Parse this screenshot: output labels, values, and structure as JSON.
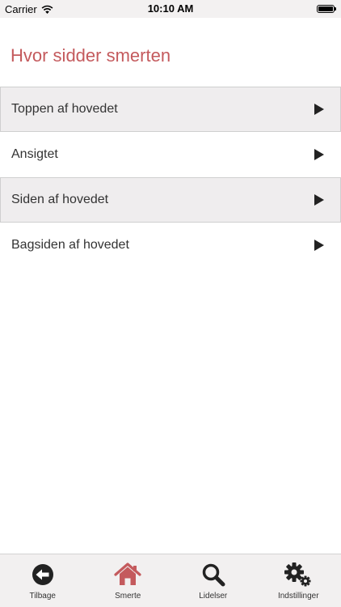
{
  "status_bar": {
    "carrier": "Carrier",
    "time": "10:10 AM",
    "battery_level": 1.0
  },
  "page": {
    "title": "Hvor sidder smerten",
    "title_color": "#c45a5d"
  },
  "list": {
    "items": [
      {
        "label": "Toppen af hovedet"
      },
      {
        "label": "Ansigtet"
      },
      {
        "label": "Siden af hovedet"
      },
      {
        "label": "Bagsiden af hovedet"
      }
    ]
  },
  "tabbar": {
    "active_color": "#c45a5d",
    "items": [
      {
        "label": "Tilbage",
        "icon": "back-arrow-circle-icon"
      },
      {
        "label": "Smerte",
        "icon": "home-icon",
        "active": true
      },
      {
        "label": "Lidelser",
        "icon": "search-icon"
      },
      {
        "label": "Indstillinger",
        "icon": "gears-icon"
      }
    ]
  }
}
